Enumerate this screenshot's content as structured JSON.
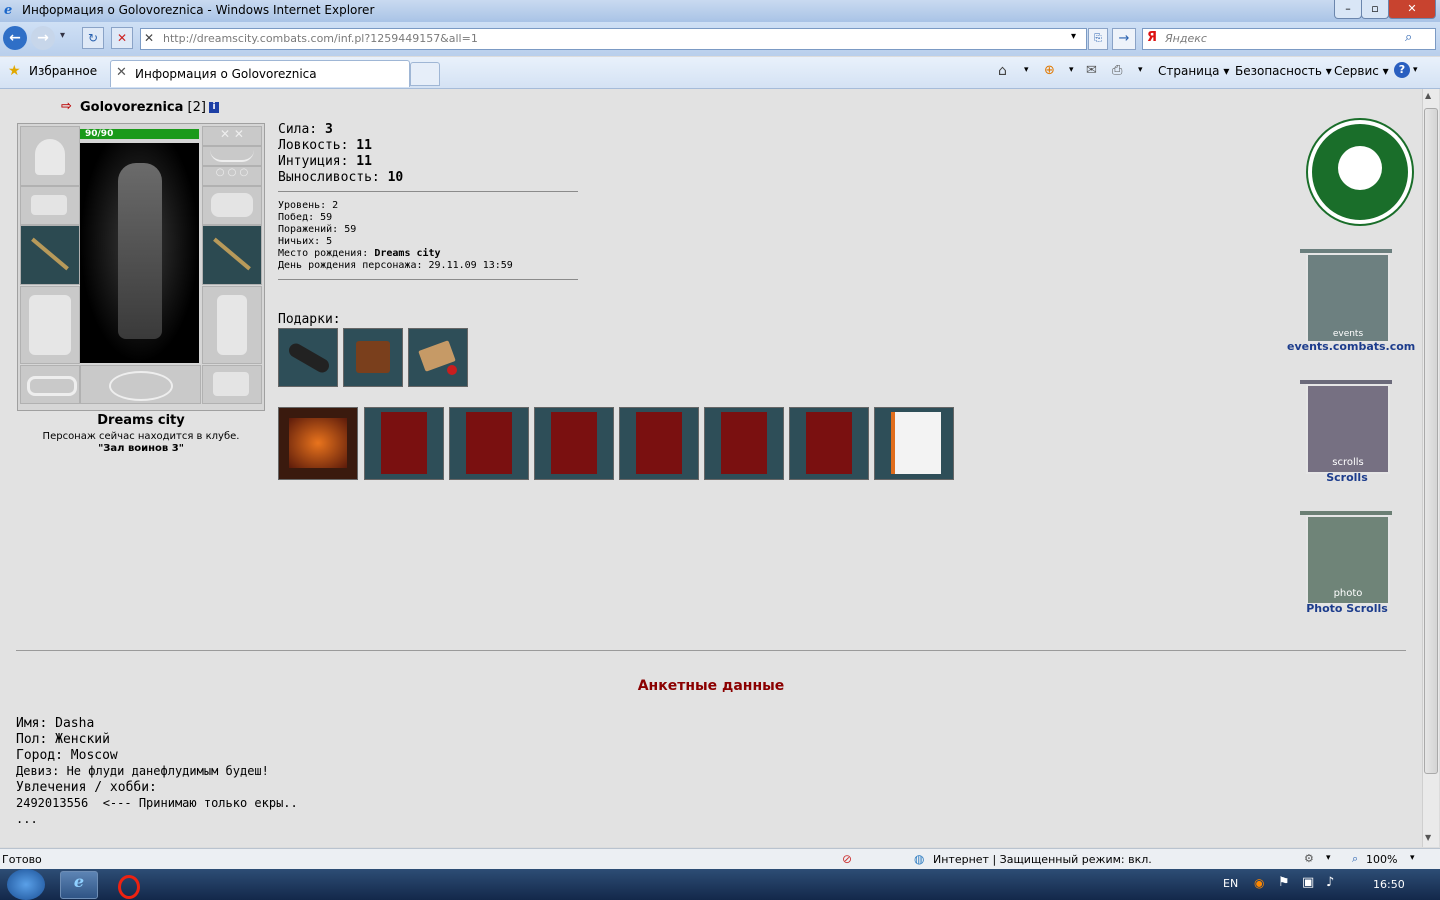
{
  "window": {
    "title": "Информация о Golovoreznica - Windows Internet Explorer",
    "address": "http://dreamscity.combats.com/inf.pl?1259449157&all=1",
    "search_placeholder": "Яндекс",
    "favorites_label": "Избранное",
    "tab_title": "Информация о Golovoreznica",
    "commands": [
      "Страница",
      "Безопасность",
      "Сервис"
    ]
  },
  "character": {
    "name": "Golovoreznica",
    "level_tag": "[2]",
    "hp": "90/90",
    "hp_fraction": 1.0,
    "city": "Dreams city",
    "location_line": "Персонаж сейчас находится в клубе.",
    "location_room": "\"Зал воинов 3\""
  },
  "stats": [
    {
      "label": "Сила:",
      "value": "3"
    },
    {
      "label": "Ловкость:",
      "value": "11"
    },
    {
      "label": "Интуиция:",
      "value": "11"
    },
    {
      "label": "Выносливость:",
      "value": "10"
    }
  ],
  "info": {
    "level": "Уровень: 2",
    "wins": "Побед: 59",
    "losses": "Поражений: 59",
    "draws": "Ничьих: 5",
    "birthplace_label": "Место рождения:",
    "birthplace": "Dreams city",
    "birthday": "День рождения персонажа: 29.11.09 13:59"
  },
  "gifts_label": "Подарки:",
  "banners": [
    {
      "label": "events.combats.com",
      "caption": "events"
    },
    {
      "label": "Scrolls",
      "caption": "scrolls"
    },
    {
      "label": "Photo Scrolls",
      "caption": "photo"
    }
  ],
  "profile": {
    "heading": "Анкетные данные",
    "name": "Имя: Dasha",
    "gender": "Пол: Женский",
    "city": "Город: Moscow",
    "motto": "Девиз: Не флуди данефлудимым будеш!",
    "hobby_label": "Увлечения / хобби:",
    "hobby_line": "2492013556  <--- Принимаю только екры..",
    "ellipsis": "..."
  },
  "status": {
    "left": "Готово",
    "zone": "Интернет | Защищенный режим: вкл.",
    "zoom": "100%"
  },
  "taskbar": {
    "lang": "EN",
    "time": "16:50"
  },
  "colors": {
    "hp_bar": "#1a9a1a",
    "heading": "#8b0000",
    "banner_link": "#1c3c8c"
  }
}
